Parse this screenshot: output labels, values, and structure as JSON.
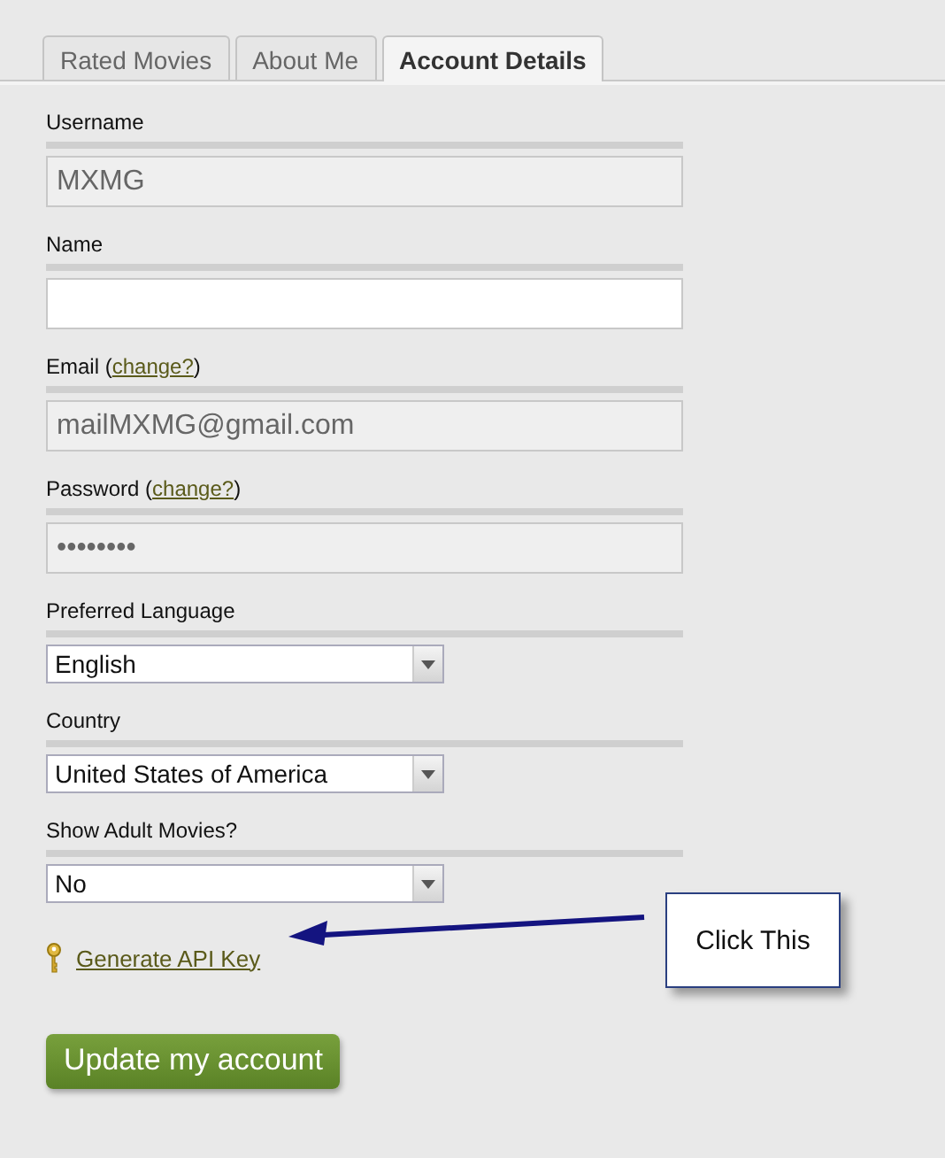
{
  "tabs": [
    {
      "label": "Rated Movies",
      "selected": false
    },
    {
      "label": "About Me",
      "selected": false
    },
    {
      "label": "Account Details",
      "selected": true
    }
  ],
  "fields": [
    {
      "label": "Username",
      "kind": "text",
      "value": "MXMG",
      "disabled": true
    },
    {
      "label": "Name",
      "kind": "text",
      "disabled": false
    },
    {
      "label": "Email (",
      "link": "change?",
      "after": ")",
      "kind": "text",
      "value": "mailMXMG@gmail.com",
      "disabled": true
    },
    {
      "label": "Password (",
      "link": "change?",
      "after": ")",
      "kind": "text",
      "value": "••••••••",
      "disabled": true
    },
    {
      "label": "Preferred Language",
      "kind": "select",
      "value": "English"
    },
    {
      "label": "Country",
      "kind": "select",
      "value": "United States of America"
    },
    {
      "label": "Show Adult Movies?",
      "kind": "select",
      "value": "No"
    }
  ],
  "api_link": "Generate API Key",
  "callout": "Click This",
  "submit": "Update my account"
}
